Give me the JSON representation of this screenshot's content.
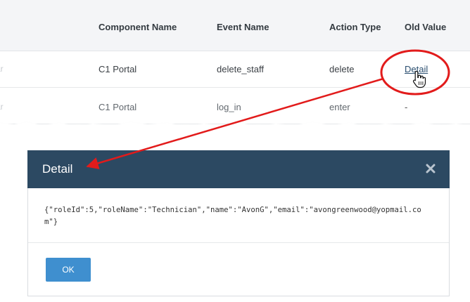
{
  "table": {
    "headers": {
      "component": "Component Name",
      "event": "Event Name",
      "action": "Action Type",
      "old_value": "Old Value"
    },
    "rows": [
      {
        "fragment": "ar",
        "component": "C1 Portal",
        "event": "delete_staff",
        "action": "delete",
        "old_value": "Detail"
      },
      {
        "fragment": "ar",
        "component": "C1 Portal",
        "event": "log_in",
        "action": "enter",
        "old_value": "-"
      }
    ]
  },
  "dialog": {
    "title": "Detail",
    "close_icon": "close-icon",
    "content": "{\"roleId\":5,\"roleName\":\"Technician\",\"name\":\"AvonG\",\"email\":\"avongreenwood@yopmail.com\"}",
    "ok_label": "OK"
  },
  "annotation": {
    "color": "#e21b1b"
  },
  "colors": {
    "header_bg": "#2c4962",
    "button_bg": "#3f8fcf",
    "link": "#2b4f70"
  },
  "icons": {
    "cursor": "hand-pointer-icon"
  }
}
